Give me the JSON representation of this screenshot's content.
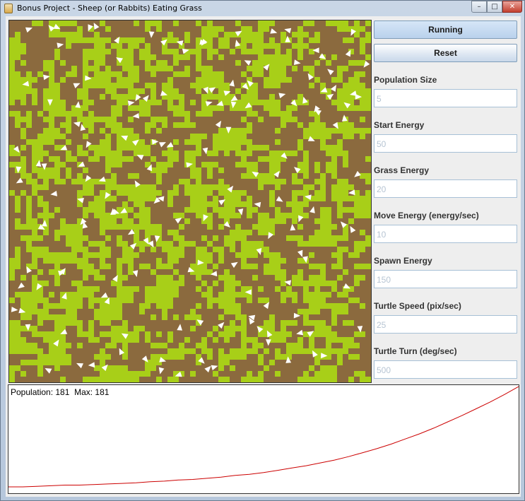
{
  "window": {
    "title": "Bonus Project - Sheep (or Rabbits) Eating Grass",
    "controls": {
      "minimize": "–",
      "maximize": "□",
      "close": "✕"
    },
    "icon": "java-cup-icon"
  },
  "simulation": {
    "grass_color": "#a8cf18",
    "dirt_color": "#8b6a3e",
    "turtle_color": "#ffffff"
  },
  "controls": {
    "running_label": "Running",
    "reset_label": "Reset"
  },
  "params": [
    {
      "label": "Population Size",
      "value": "5"
    },
    {
      "label": "Start Energy",
      "value": "50"
    },
    {
      "label": "Grass Energy",
      "value": "20"
    },
    {
      "label": "Move Energy (energy/sec)",
      "value": "10"
    },
    {
      "label": "Spawn Energy",
      "value": "150"
    },
    {
      "label": "Turtle Speed (pix/sec)",
      "value": "25"
    },
    {
      "label": "Turtle Turn (deg/sec)",
      "value": "500"
    }
  ],
  "graph": {
    "readout": "Population: 181  Max: 181",
    "line_color": "#cc0000",
    "population_series": [
      5,
      5,
      6,
      7,
      8,
      8,
      9,
      10,
      11,
      12,
      14,
      15,
      17,
      18,
      20,
      22,
      25,
      27,
      30,
      34,
      38,
      42,
      47,
      52,
      58,
      65,
      72,
      80,
      89,
      98,
      108,
      119,
      130,
      142,
      154,
      167,
      181
    ]
  }
}
